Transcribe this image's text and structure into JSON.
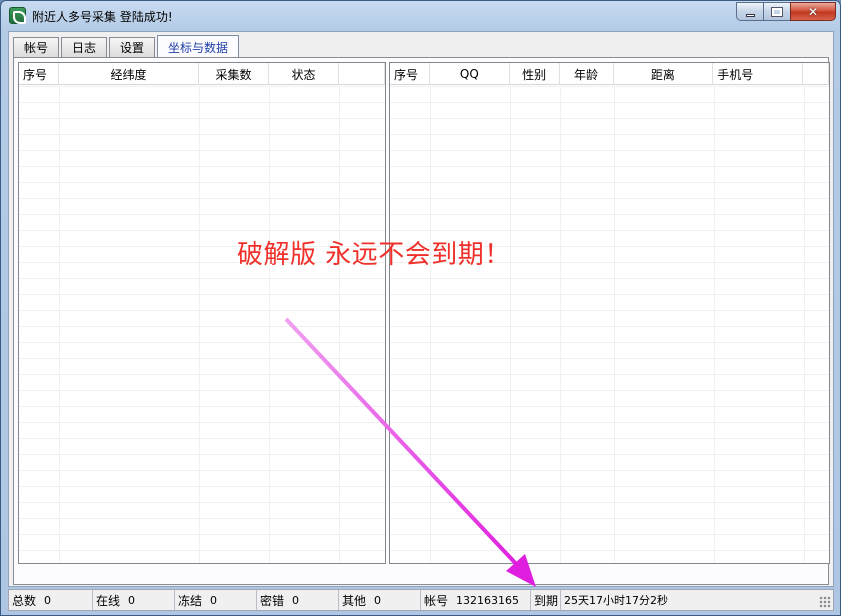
{
  "window": {
    "title": "附近人多号采集 登陆成功!",
    "icon": "app-logo-icon"
  },
  "tabs": [
    {
      "label": "帐号",
      "active": false
    },
    {
      "label": "日志",
      "active": false
    },
    {
      "label": "设置",
      "active": false
    },
    {
      "label": "坐标与数据",
      "active": true
    }
  ],
  "left_grid": {
    "columns": [
      "序号",
      "经纬度",
      "采集数",
      "状态",
      ""
    ],
    "rows": []
  },
  "right_grid": {
    "columns": [
      "序号",
      "QQ",
      "性别",
      "年龄",
      "距离",
      "手机号",
      ""
    ],
    "rows": []
  },
  "overlay": {
    "text": "破解版 永远不会到期！",
    "color": "#f0302a",
    "arrow_color": "#e63ce6"
  },
  "statusbar": {
    "total_label": "总数",
    "total_value": "0",
    "online_label": "在线",
    "online_value": "0",
    "frozen_label": "冻结",
    "frozen_value": "0",
    "pwderr_label": "密错",
    "pwderr_value": "0",
    "other_label": "其他",
    "other_value": "0",
    "account_label": "帐号",
    "account_value": "132163165",
    "expire_label": "到期",
    "expire_value": "25天17小时17分2秒"
  }
}
